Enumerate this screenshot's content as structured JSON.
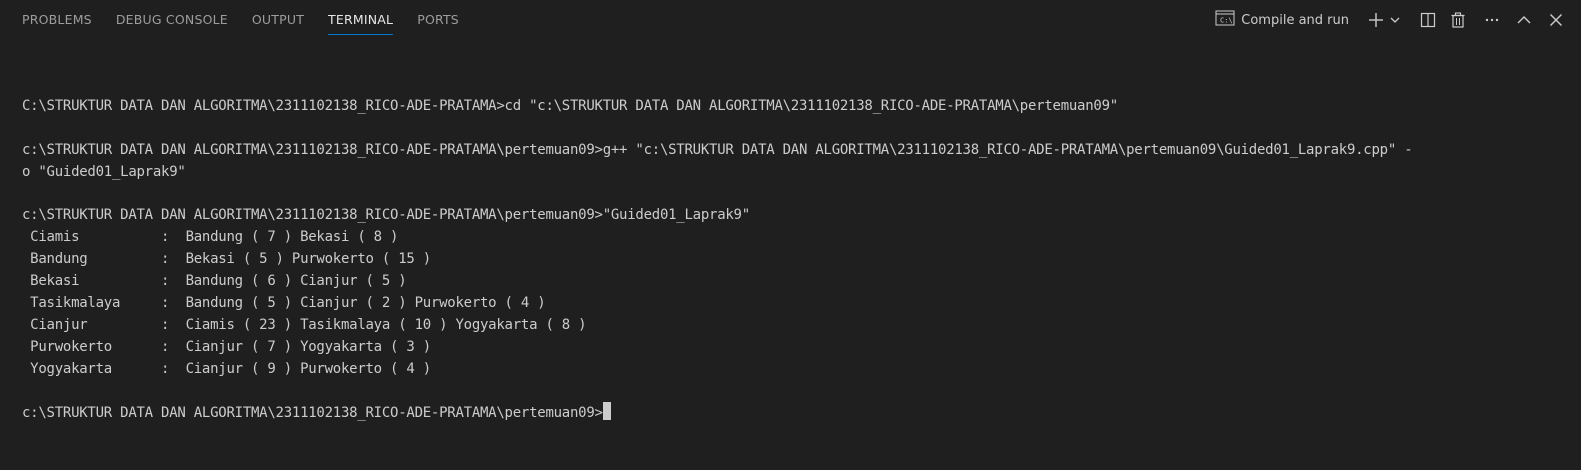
{
  "tabs": [
    {
      "label": "PROBLEMS",
      "active": false
    },
    {
      "label": "DEBUG CONSOLE",
      "active": false
    },
    {
      "label": "OUTPUT",
      "active": false
    },
    {
      "label": "TERMINAL",
      "active": true
    },
    {
      "label": "PORTS",
      "active": false
    }
  ],
  "actions": {
    "launch_profile_label": "Compile and run",
    "icons": [
      "terminal-icon",
      "plus-icon",
      "chevron-down-icon",
      "split-icon",
      "trash-icon",
      "more-icon",
      "maximize-icon",
      "close-icon"
    ]
  },
  "terminal": {
    "lines": [
      "",
      "C:\\STRUKTUR DATA DAN ALGORITMA\\2311102138_RICO-ADE-PRATAMA>cd \"c:\\STRUKTUR DATA DAN ALGORITMA\\2311102138_RICO-ADE-PRATAMA\\pertemuan09\"",
      "",
      "c:\\STRUKTUR DATA DAN ALGORITMA\\2311102138_RICO-ADE-PRATAMA\\pertemuan09>g++ \"c:\\STRUKTUR DATA DAN ALGORITMA\\2311102138_RICO-ADE-PRATAMA\\pertemuan09\\Guided01_Laprak9.cpp\" -",
      "o \"Guided01_Laprak9\"",
      "",
      "c:\\STRUKTUR DATA DAN ALGORITMA\\2311102138_RICO-ADE-PRATAMA\\pertemuan09>\"Guided01_Laprak9\"",
      " Ciamis          :  Bandung ( 7 ) Bekasi ( 8 )",
      " Bandung         :  Bekasi ( 5 ) Purwokerto ( 15 )",
      " Bekasi          :  Bandung ( 6 ) Cianjur ( 5 )",
      " Tasikmalaya     :  Bandung ( 5 ) Cianjur ( 2 ) Purwokerto ( 4 )",
      " Cianjur         :  Ciamis ( 23 ) Tasikmalaya ( 10 ) Yogyakarta ( 8 )",
      " Purwokerto      :  Cianjur ( 7 ) Yogyakarta ( 3 )",
      " Yogyakarta      :  Cianjur ( 9 ) Purwokerto ( 4 )",
      ""
    ],
    "prompt": "c:\\STRUKTUR DATA DAN ALGORITMA\\2311102138_RICO-ADE-PRATAMA\\pertemuan09>"
  },
  "colors": {
    "background": "#1f1f1f",
    "text": "#cccccc",
    "active_tab_underline": "#0078d4"
  }
}
